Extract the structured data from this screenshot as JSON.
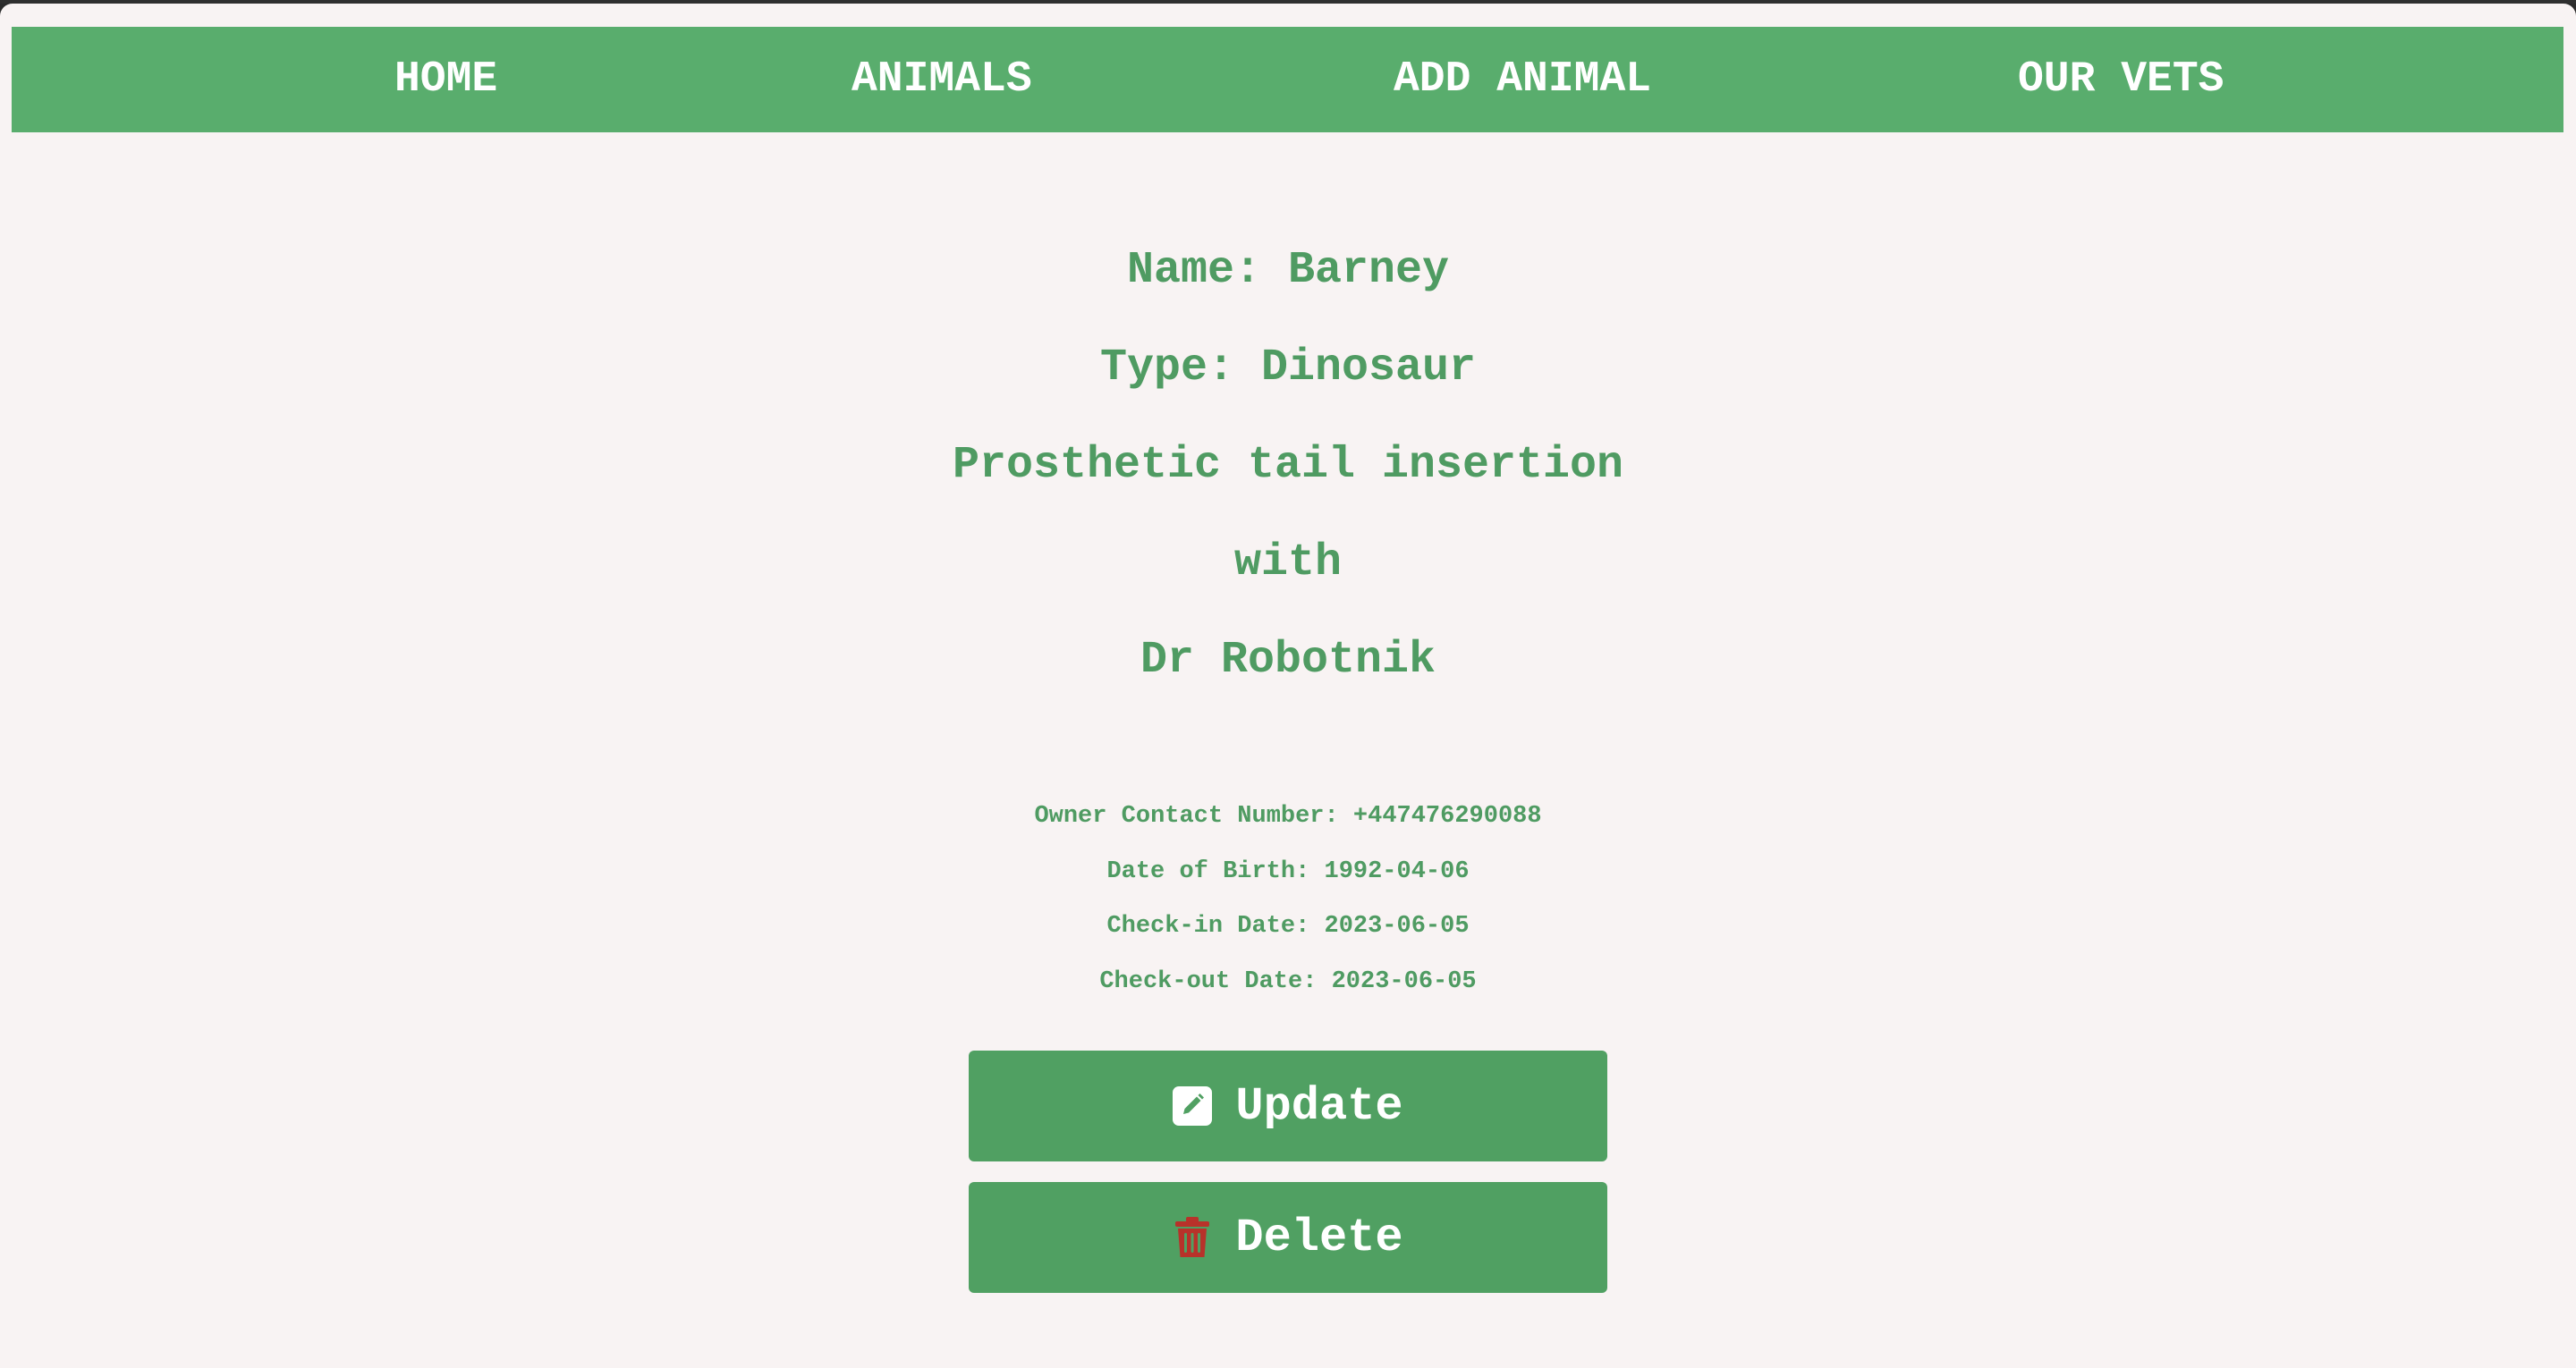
{
  "nav": {
    "items": [
      {
        "label": "HOME"
      },
      {
        "label": "ANIMALS"
      },
      {
        "label": "ADD ANIMAL"
      },
      {
        "label": "OUR VETS"
      }
    ]
  },
  "animal": {
    "name_line": "Name: Barney",
    "type_line": "Type: Dinosaur",
    "procedure": "Prosthetic tail insertion",
    "with_text": "with",
    "vet": "Dr Robotnik",
    "details": {
      "contact": "Owner Contact Number: +447476290088",
      "dob": "Date of Birth: 1992-04-06",
      "checkin": "Check-in Date: 2023-06-05",
      "checkout": "Check-out Date: 2023-06-05"
    }
  },
  "actions": {
    "update_label": "Update",
    "update_icon": "pencil-square-icon",
    "delete_label": "Delete",
    "delete_icon": "trash-icon"
  },
  "colors": {
    "nav_bg": "#59ad6d",
    "text_green": "#4f9b62",
    "button_bg": "#50a062",
    "page_bg": "#f8f3f3",
    "trash_red": "#b8322a"
  }
}
